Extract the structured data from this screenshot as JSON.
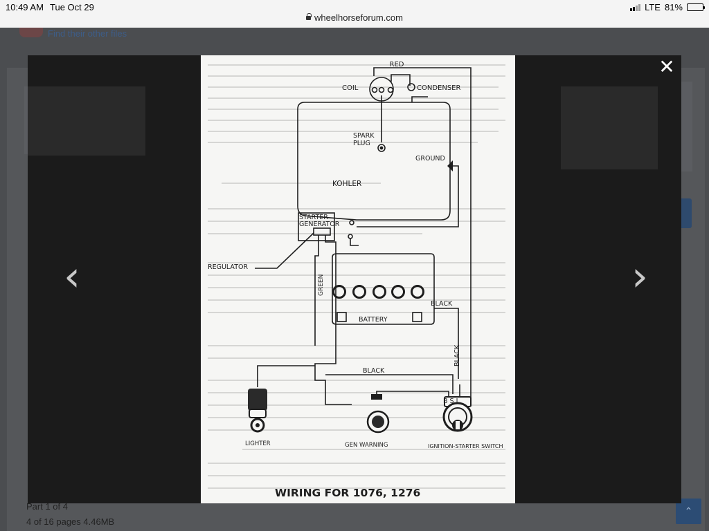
{
  "status_bar": {
    "time": "10:49 AM",
    "day": "Tue Oct 29",
    "network": "LTE",
    "battery": "81%",
    "battery_fraction": 0.81
  },
  "browser": {
    "url": "wheelhorseforum.com"
  },
  "background_page": {
    "link_text": "Find their other files",
    "part_text": "Part 1 of 4",
    "pages_text": "4 of 16 pages 4.46MB"
  },
  "lightbox": {
    "close_icon": "close-icon",
    "prev_icon": "chevron-left-icon",
    "next_icon": "chevron-right-icon"
  },
  "diagram": {
    "labels": {
      "red": "RED",
      "coil": "COIL",
      "condenser": "CONDENSER",
      "spark": "SPARK",
      "plug": "PLUG",
      "ground": "GROUND",
      "kohler": "KOHLER",
      "starter": "STARTER",
      "generator": "GENERATOR",
      "regulator": "REGULATOR",
      "green": "GREEN",
      "black_battery": "BLACK",
      "battery": "BATTERY",
      "black_vertical": "BLACK",
      "black_horizontal": "BLACK",
      "b_s_i": "B S I",
      "lighter": "LIGHTER",
      "gen_warning": "GEN WARNING",
      "ignition_switch": "IGNITION-STARTER SWITCH"
    },
    "title": "WIRING FOR 1076, 1276"
  }
}
